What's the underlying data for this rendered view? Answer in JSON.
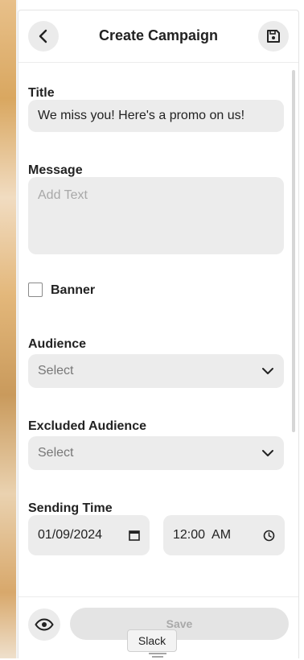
{
  "header": {
    "title": "Create Campaign"
  },
  "form": {
    "title_label": "Title",
    "title_value": "We miss you! Here's a promo on us!",
    "message_label": "Message",
    "message_placeholder": "Add Text",
    "banner_label": "Banner",
    "banner_checked": false,
    "audience_label": "Audience",
    "audience_value": "Select",
    "excluded_label": "Excluded Audience",
    "excluded_value": "Select",
    "sending_time_label": "Sending Time",
    "date_value": "01/09/2024",
    "time_value": "12:00  AM"
  },
  "footer": {
    "save_label": "Save"
  },
  "tooltip": {
    "text": "Slack"
  },
  "icons": {
    "back": "chevron-left-icon",
    "save": "floppy-disk-icon",
    "dropdown": "chevron-down-icon",
    "calendar": "calendar-icon",
    "clock": "clock-icon",
    "preview": "eye-icon"
  }
}
